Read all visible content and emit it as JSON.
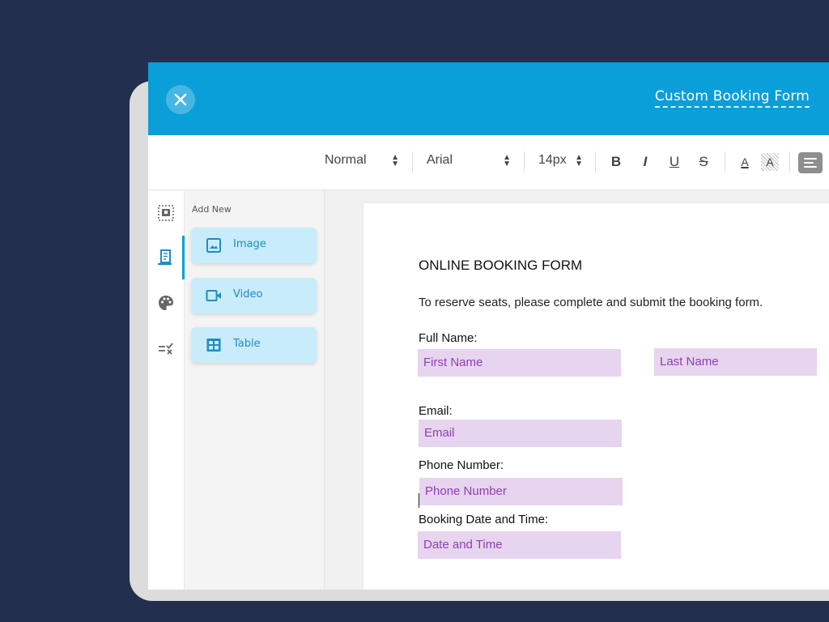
{
  "header": {
    "form_title": "Custom Booking Form"
  },
  "toolbar": {
    "paragraph_style": "Normal",
    "font_family": "Arial",
    "font_size": "14px",
    "bold_label": "B",
    "italic_label": "I",
    "underline_label": "U",
    "strike_label": "S",
    "font_color_label": "A",
    "highlight_label": "A"
  },
  "rail": {
    "items": [
      "frame-icon",
      "document-icon",
      "palette-icon",
      "checklist-icon"
    ],
    "active_index": 1
  },
  "panel": {
    "heading": "Add New",
    "items": [
      {
        "label": "Image",
        "icon": "image-icon"
      },
      {
        "label": "Video",
        "icon": "video-icon"
      },
      {
        "label": "Table",
        "icon": "table-icon"
      }
    ]
  },
  "document": {
    "title": "ONLINE BOOKING FORM",
    "intro": "To reserve seats, please complete and submit the booking form.",
    "full_name_label": "Full Name:",
    "first_name_placeholder": "First Name",
    "last_name_placeholder": "Last Name",
    "email_label": "Email:",
    "email_placeholder": "Email",
    "phone_label": "Phone Number:",
    "phone_placeholder": "Phone Number",
    "booking_label": "Booking Date and Time:",
    "booking_placeholder": "Date and Time"
  },
  "colors": {
    "background": "#222f4f",
    "header": "#0a9fd8",
    "field_fill": "#e7d4ef",
    "field_text": "#8f3fb0",
    "add_button": "#c9ecfa"
  }
}
